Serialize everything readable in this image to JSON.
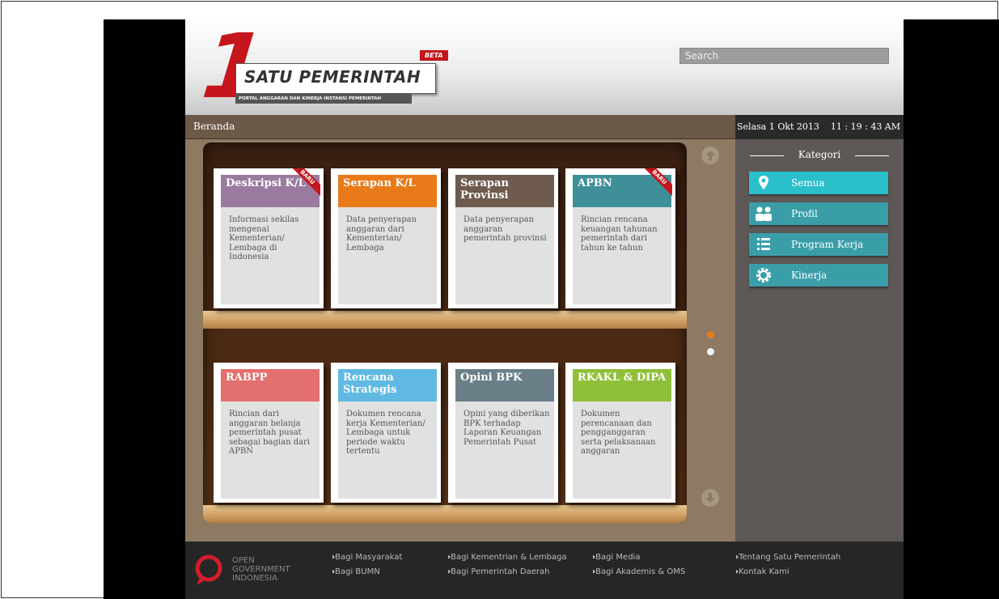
{
  "header": {
    "logo_number": "1",
    "logo_title": "SATU  PEMERINTAH",
    "logo_subtitle": "PORTAL ANGGARAN DAN KINERJA INSTANSI PEMERINTAH",
    "beta_badge": "BETA",
    "search_placeholder": "Search"
  },
  "breadcrumb": "Beranda",
  "datetime": {
    "date": "Selasa 1 Okt 2013",
    "time": "11 : 19 : 43 AM"
  },
  "colors": {
    "deskripsi": "#9b7aa0",
    "serapan_kl": "#e87a1a",
    "serapan_prov": "#6e5b4e",
    "apbn": "#3f8f99",
    "rabpp": "#e36f6f",
    "renstra": "#5fb9e2",
    "opini": "#6a7f88",
    "rkakl": "#8fc03a"
  },
  "books": [
    {
      "title": "Deskripsi K/L",
      "desc": "Informasi sekilas mengenai Kementerian/ Lembaga di Indonesia",
      "badge": "BARU",
      "color": "#9b7aa0"
    },
    {
      "title": "Serapan K/L",
      "desc": "Data penyerapan anggaran dari Kementerian/ Lembaga",
      "badge": "",
      "color": "#e87a1a"
    },
    {
      "title": "Serapan Provinsi",
      "desc": "Data penyerapan anggaran pemerintah provinsi",
      "badge": "",
      "color": "#6e5b4e"
    },
    {
      "title": "APBN",
      "desc": "Rincian rencana keuangan tahunan pemerintah dari tahun ke tahun",
      "badge": "BARU",
      "color": "#3f8f99"
    },
    {
      "title": "RABPP",
      "desc": "Rincian dari anggaran belanja pemerintah pusat sebagai bagian dari APBN",
      "badge": "",
      "color": "#e36f6f"
    },
    {
      "title": "Rencana Strategis",
      "desc": "Dokumen rencana kerja Kementerian/ Lembaga untuk periode waktu tertentu",
      "badge": "",
      "color": "#5fb9e2"
    },
    {
      "title": "Opini BPK",
      "desc": "Opini yang diberikan BPK terhadap Laporan Keuangan Pemerintah Pusat",
      "badge": "",
      "color": "#6a7f88"
    },
    {
      "title": "RKAKL & DIPA",
      "desc": "Dokumen perencanaan dan pengganggaran serta pelaksanaan anggaran",
      "badge": "",
      "color": "#8fc03a"
    }
  ],
  "sidebar": {
    "heading": "Kategori",
    "items": [
      {
        "label": "Semua",
        "icon": "location-pin-icon"
      },
      {
        "label": "Profil",
        "icon": "people-icon"
      },
      {
        "label": "Program Kerja",
        "icon": "list-icon"
      },
      {
        "label": "Kinerja",
        "icon": "gear-icon"
      }
    ]
  },
  "footer": {
    "og_line1": "OPEN",
    "og_line2": "GOVERNMENT",
    "og_line3": "INDONESIA",
    "links": [
      "Bagi Masyarakat",
      "Bagi BUMN",
      "Bagi Kementrian & Lembaga",
      "Bagi Pemerintah Daerah",
      "Bagi Media",
      "Bagi Akademis & OMS",
      "Tentang Satu Pemerintah",
      "Kontak Kami"
    ]
  }
}
